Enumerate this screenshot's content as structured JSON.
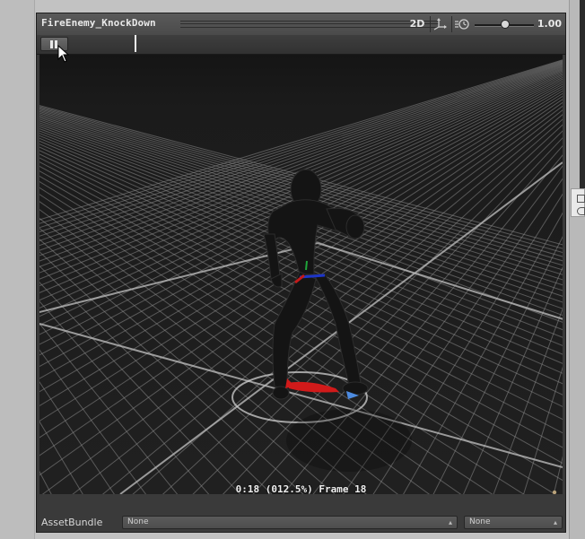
{
  "preview": {
    "title": "FireEnemy_KnockDown",
    "mode_2d_label": "2D",
    "speed_value": "1.00",
    "speed_fraction": 0.45,
    "frame_label": "0:18 (012.5%) Frame 18",
    "timeline_progress": 0.125
  },
  "assetbundle": {
    "label": "AssetBundle",
    "name_value": "None",
    "variant_value": "None"
  },
  "icons": {
    "pause": "pause-icon",
    "axes": "pivot-axes-icon",
    "speed": "playback-speed-icon",
    "avatar": "avatar-icon",
    "tag": "asset-label-tag-icon"
  },
  "colors": {
    "panel_bg": "#3a3a3a",
    "grid_line": "#8a8a8a",
    "root_arrow": "#d11a1a",
    "tag_badge": "#2f6fd6"
  }
}
